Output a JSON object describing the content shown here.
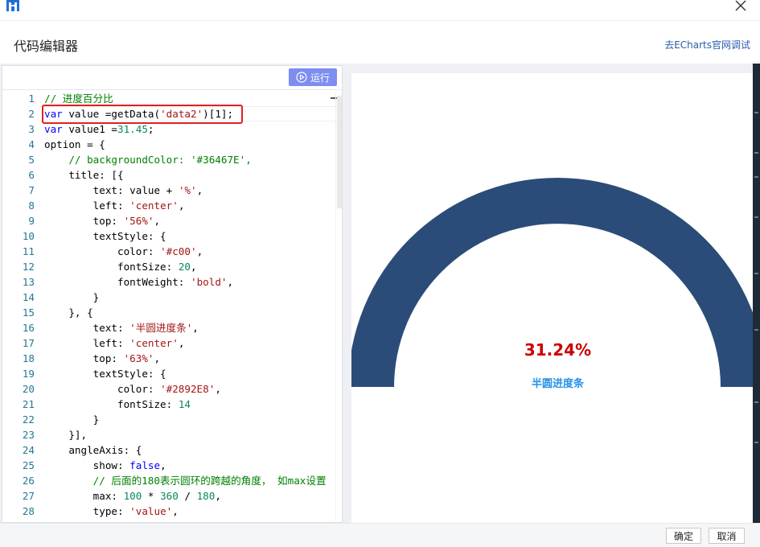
{
  "dialog": {
    "title": "代码编辑器",
    "echarts_link": "去ECharts官网调试"
  },
  "toolbar": {
    "run_label": "运行"
  },
  "editor": {
    "lines": [
      {
        "n": "1",
        "tokens": [
          {
            "t": "// 进度百分比",
            "c": "com"
          }
        ]
      },
      {
        "n": "2",
        "tokens": [
          {
            "t": "var",
            "c": "kw"
          },
          {
            "t": " value =getData(",
            "c": "plain"
          },
          {
            "t": "'data2'",
            "c": "str"
          },
          {
            "t": ")[1];",
            "c": "plain"
          }
        ]
      },
      {
        "n": "3",
        "tokens": [
          {
            "t": "var",
            "c": "kw"
          },
          {
            "t": " value1 =",
            "c": "plain"
          },
          {
            "t": "31.45",
            "c": "num"
          },
          {
            "t": ";",
            "c": "plain"
          }
        ]
      },
      {
        "n": "4",
        "tokens": [
          {
            "t": "option = {",
            "c": "plain"
          }
        ]
      },
      {
        "n": "5",
        "tokens": [
          {
            "t": "    // backgroundColor: '#36467E',",
            "c": "com"
          }
        ]
      },
      {
        "n": "6",
        "tokens": [
          {
            "t": "    title: [{",
            "c": "plain"
          }
        ]
      },
      {
        "n": "7",
        "tokens": [
          {
            "t": "        text: value + ",
            "c": "plain"
          },
          {
            "t": "'%'",
            "c": "str"
          },
          {
            "t": ",",
            "c": "plain"
          }
        ]
      },
      {
        "n": "8",
        "tokens": [
          {
            "t": "        left: ",
            "c": "plain"
          },
          {
            "t": "'center'",
            "c": "str"
          },
          {
            "t": ",",
            "c": "plain"
          }
        ]
      },
      {
        "n": "9",
        "tokens": [
          {
            "t": "        top: ",
            "c": "plain"
          },
          {
            "t": "'56%'",
            "c": "str"
          },
          {
            "t": ",",
            "c": "plain"
          }
        ]
      },
      {
        "n": "10",
        "tokens": [
          {
            "t": "        textStyle: {",
            "c": "plain"
          }
        ]
      },
      {
        "n": "11",
        "tokens": [
          {
            "t": "            color: ",
            "c": "plain"
          },
          {
            "t": "'#c00'",
            "c": "str"
          },
          {
            "t": ",",
            "c": "plain"
          }
        ]
      },
      {
        "n": "12",
        "tokens": [
          {
            "t": "            fontSize: ",
            "c": "plain"
          },
          {
            "t": "20",
            "c": "num"
          },
          {
            "t": ",",
            "c": "plain"
          }
        ]
      },
      {
        "n": "13",
        "tokens": [
          {
            "t": "            fontWeight: ",
            "c": "plain"
          },
          {
            "t": "'bold'",
            "c": "str"
          },
          {
            "t": ",",
            "c": "plain"
          }
        ]
      },
      {
        "n": "14",
        "tokens": [
          {
            "t": "        }",
            "c": "plain"
          }
        ]
      },
      {
        "n": "15",
        "tokens": [
          {
            "t": "    }, {",
            "c": "plain"
          }
        ]
      },
      {
        "n": "16",
        "tokens": [
          {
            "t": "        text: ",
            "c": "plain"
          },
          {
            "t": "'半圆进度条'",
            "c": "str"
          },
          {
            "t": ",",
            "c": "plain"
          }
        ]
      },
      {
        "n": "17",
        "tokens": [
          {
            "t": "        left: ",
            "c": "plain"
          },
          {
            "t": "'center'",
            "c": "str"
          },
          {
            "t": ",",
            "c": "plain"
          }
        ]
      },
      {
        "n": "18",
        "tokens": [
          {
            "t": "        top: ",
            "c": "plain"
          },
          {
            "t": "'63%'",
            "c": "str"
          },
          {
            "t": ",",
            "c": "plain"
          }
        ]
      },
      {
        "n": "19",
        "tokens": [
          {
            "t": "        textStyle: {",
            "c": "plain"
          }
        ]
      },
      {
        "n": "20",
        "tokens": [
          {
            "t": "            color: ",
            "c": "plain"
          },
          {
            "t": "'#2892E8'",
            "c": "str"
          },
          {
            "t": ",",
            "c": "plain"
          }
        ]
      },
      {
        "n": "21",
        "tokens": [
          {
            "t": "            fontSize: ",
            "c": "plain"
          },
          {
            "t": "14",
            "c": "num"
          }
        ]
      },
      {
        "n": "22",
        "tokens": [
          {
            "t": "        }",
            "c": "plain"
          }
        ]
      },
      {
        "n": "23",
        "tokens": [
          {
            "t": "    }],",
            "c": "plain"
          }
        ]
      },
      {
        "n": "24",
        "tokens": [
          {
            "t": "    angleAxis: {",
            "c": "plain"
          }
        ]
      },
      {
        "n": "25",
        "tokens": [
          {
            "t": "        show: ",
            "c": "plain"
          },
          {
            "t": "false",
            "c": "kw"
          },
          {
            "t": ",",
            "c": "plain"
          }
        ]
      },
      {
        "n": "26",
        "tokens": [
          {
            "t": "        // 后面的180表示圆环的跨越的角度， 如max设置",
            "c": "com"
          }
        ]
      },
      {
        "n": "27",
        "tokens": [
          {
            "t": "        max: ",
            "c": "plain"
          },
          {
            "t": "100",
            "c": "num"
          },
          {
            "t": " * ",
            "c": "plain"
          },
          {
            "t": "360",
            "c": "num"
          },
          {
            "t": " / ",
            "c": "plain"
          },
          {
            "t": "180",
            "c": "num"
          },
          {
            "t": ",",
            "c": "plain"
          }
        ]
      },
      {
        "n": "28",
        "tokens": [
          {
            "t": "        type: ",
            "c": "plain"
          },
          {
            "t": "'value'",
            "c": "str"
          },
          {
            "t": ",",
            "c": "plain"
          }
        ]
      }
    ]
  },
  "preview": {
    "value_label": "31.24%",
    "subtitle": "半圆进度条",
    "value_color": "#cc0000",
    "subtitle_color": "#2892e8",
    "ring_color": "#2b4c78"
  },
  "footer": {
    "ok_label": "确定",
    "cancel_label": "取消"
  }
}
